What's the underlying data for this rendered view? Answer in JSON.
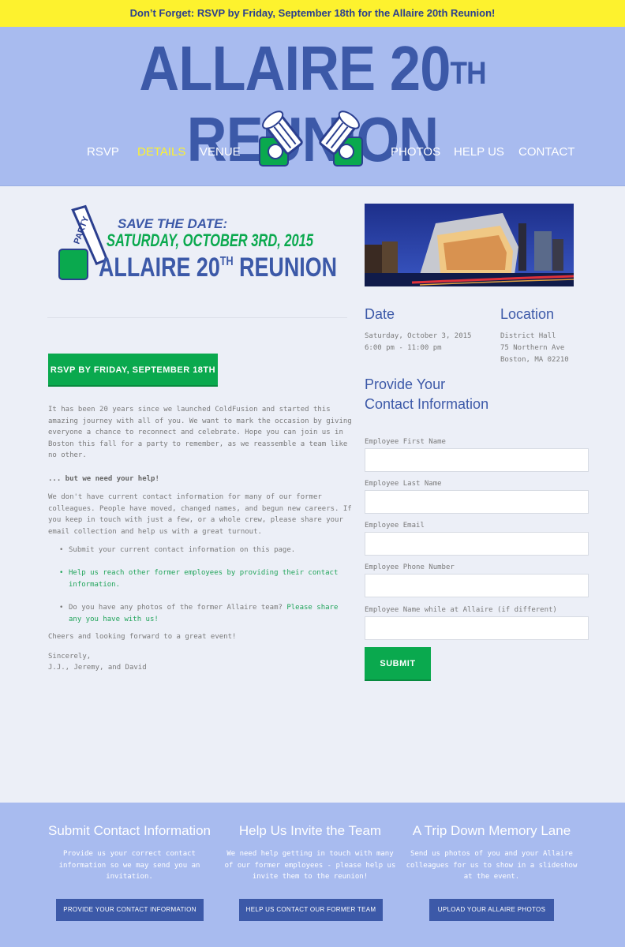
{
  "banner": {
    "text": "Don’t Forget: RSVP by Friday, September 18th for the Allaire 20th Reunion!"
  },
  "header": {
    "title_main": "ALLAIRE 20",
    "title_sup": "TH",
    "title_end": " REUNION",
    "nav_left": [
      "RSVP",
      "DETAILS",
      "VENUE"
    ],
    "nav_right": [
      "PHOTOS",
      "HELP US",
      "CONTACT"
    ],
    "active_nav": "DETAILS"
  },
  "save_the_date": {
    "line1": "SAVE THE DATE:",
    "line2": "SATURDAY, OCTOBER 3RD, 2015",
    "line3_main": "ALLAIRE 20",
    "line3_sup": "TH",
    "line3_end": " REUNION",
    "party_text": "PARTY"
  },
  "rsvp_button": "RSVP BY FRIDAY, SEPTEMBER 18TH",
  "intro": {
    "p1": "It has been 20 years since we launched ColdFusion and started this amazing journey with all of you.  We want to mark the occasion by giving everyone a chance to reconnect and celebrate.  Hope you can join us in Boston this fall for a party to remember, as we reassemble a team like no other.",
    "need_help": "... but we need your help!",
    "p2": "We don't have current contact information for many of our former colleagues.  People have moved, changed names, and begun new careers.  If you keep in touch with just a few, or a whole crew, please share your email collection and help us with a great turnout.",
    "bullets": {
      "b1": "Submit your current contact information on this page.",
      "b2": "Help us reach other former employees by providing their contact information.",
      "b3_text": "Do you have any photos of the former Allaire team? ",
      "b3_link": "Please share any you have with us!"
    },
    "cheers": "Cheers and looking forward to a great event!",
    "sincerely": "Sincerely,",
    "signature": "J.J., Jeremy, and David"
  },
  "event": {
    "date_heading": "Date",
    "date_line1": "Saturday, October 3, 2015",
    "date_line2": "6:00 pm - 11:00 pm",
    "location_heading": "Location",
    "loc_line1": "District Hall",
    "loc_line2": "75 Northern Ave",
    "loc_line3": "Boston, MA 02210"
  },
  "form": {
    "heading_line1": "Provide Your",
    "heading_line2": "Contact Information",
    "fields": [
      "Employee First Name",
      "Employee Last Name",
      "Employee Email",
      "Employee Phone Number",
      "Employee Name while at Allaire (if different)"
    ],
    "submit": "SUBMIT"
  },
  "footer": {
    "columns": [
      {
        "title": "Submit Contact Information",
        "text": "Provide us your correct contact information so we may send you an invitation.",
        "button": "PROVIDE YOUR CONTACT INFORMATION"
      },
      {
        "title": "Help Us Invite the Team",
        "text": "We need help getting in touch with many of our former employees - please help us invite them to the reunion!",
        "button": "HELP US CONTACT OUR FORMER TEAM"
      },
      {
        "title": "A Trip Down Memory Lane",
        "text": "Send us photos of you and your Allaire colleagues for us to show in a slideshow at the event.",
        "button": "UPLOAD YOUR ALLAIRE PHOTOS"
      }
    ]
  },
  "colors": {
    "banner_bg": "#fdf22e",
    "header_bg": "#a8bbef",
    "brand_blue": "#3c59a8",
    "brand_green": "#0aa94e",
    "page_bg": "#eceff7"
  }
}
